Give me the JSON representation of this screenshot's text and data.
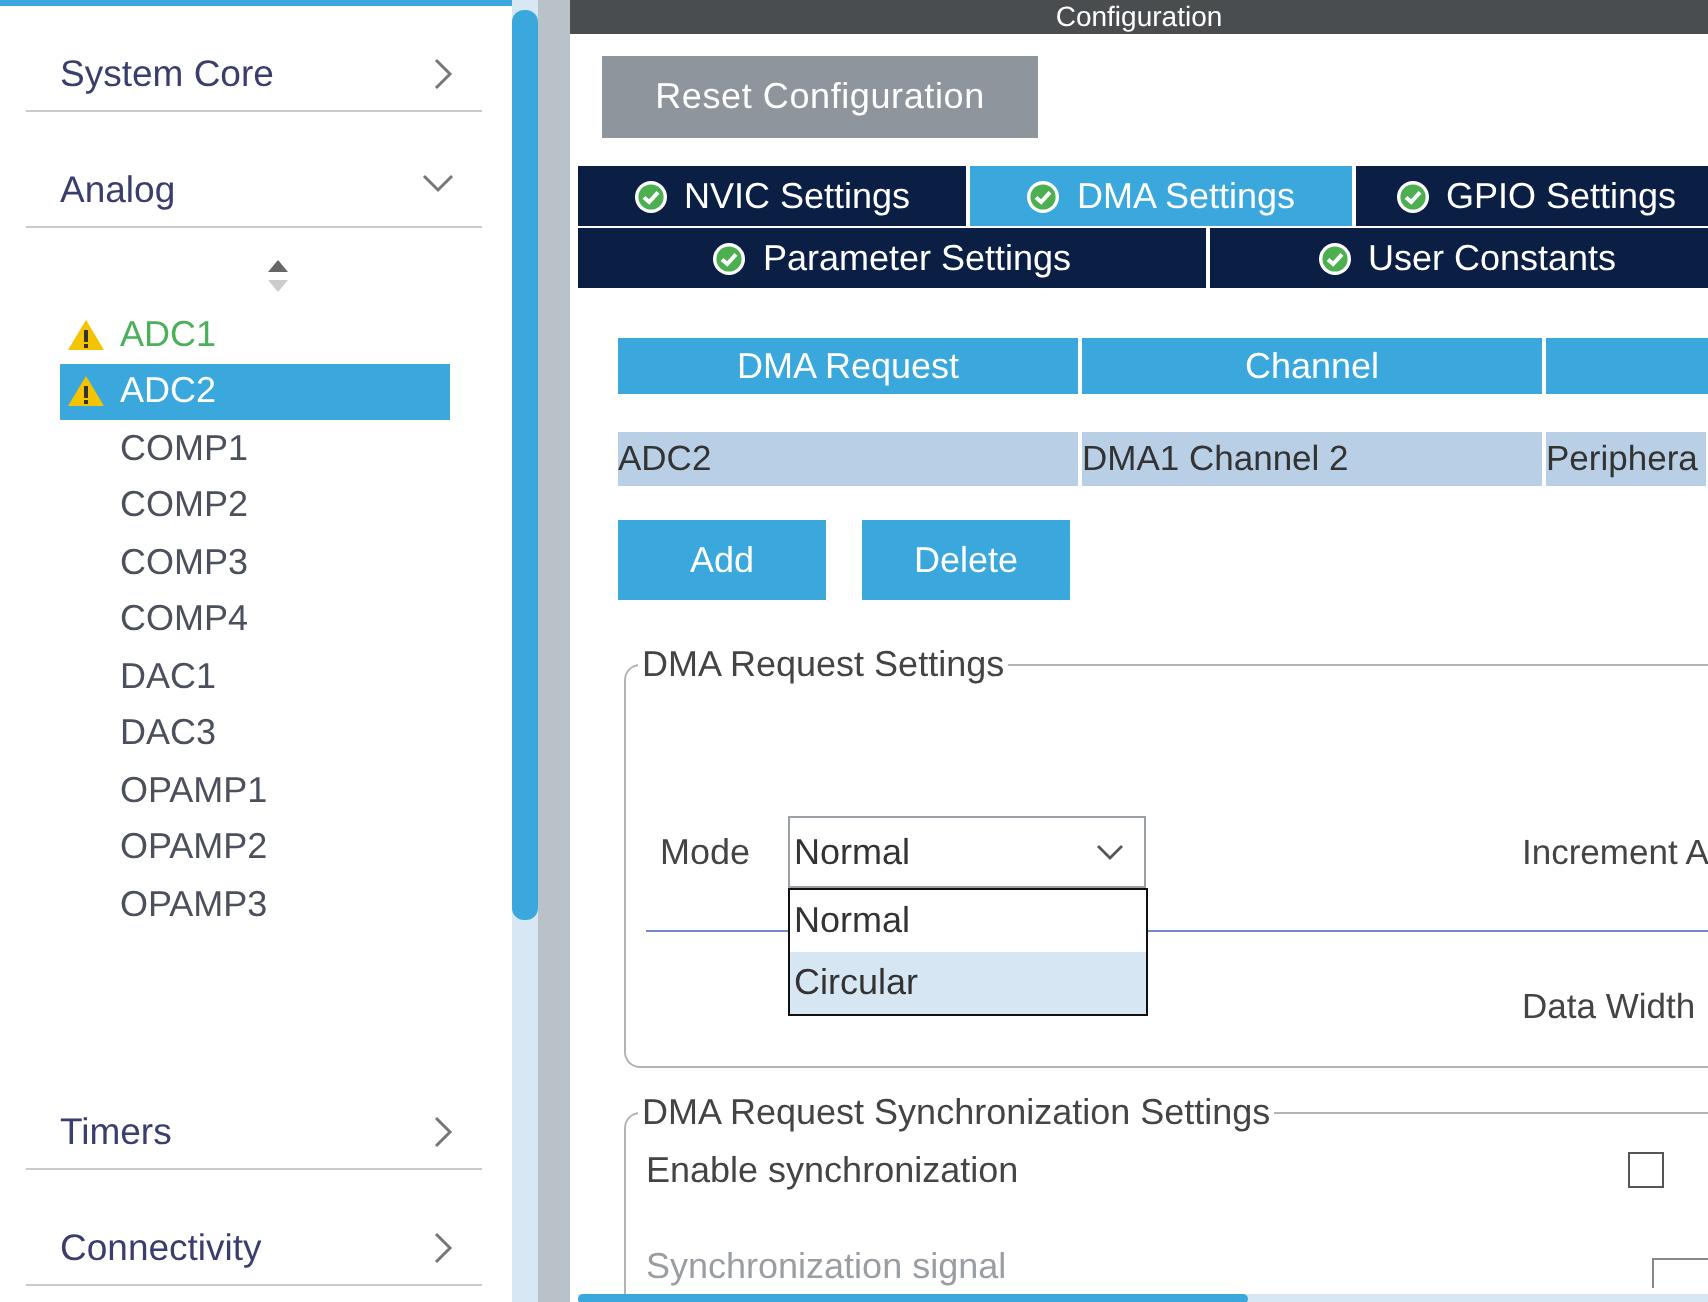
{
  "sidebar": {
    "categories": [
      {
        "label": "System Core",
        "expanded": false
      },
      {
        "label": "Analog",
        "expanded": true,
        "items": [
          {
            "label": "ADC1",
            "warning": true,
            "configured": true,
            "selected": false
          },
          {
            "label": "ADC2",
            "warning": true,
            "configured": true,
            "selected": true
          },
          {
            "label": "COMP1",
            "warning": false,
            "configured": false,
            "selected": false
          },
          {
            "label": "COMP2",
            "warning": false,
            "configured": false,
            "selected": false
          },
          {
            "label": "COMP3",
            "warning": false,
            "configured": false,
            "selected": false
          },
          {
            "label": "COMP4",
            "warning": false,
            "configured": false,
            "selected": false
          },
          {
            "label": "DAC1",
            "warning": false,
            "configured": false,
            "selected": false
          },
          {
            "label": "DAC3",
            "warning": false,
            "configured": false,
            "selected": false
          },
          {
            "label": "OPAMP1",
            "warning": false,
            "configured": false,
            "selected": false
          },
          {
            "label": "OPAMP2",
            "warning": false,
            "configured": false,
            "selected": false
          },
          {
            "label": "OPAMP3",
            "warning": false,
            "configured": false,
            "selected": false
          }
        ]
      },
      {
        "label": "Timers",
        "expanded": false
      },
      {
        "label": "Connectivity",
        "expanded": false
      }
    ]
  },
  "panel": {
    "title": "Configuration",
    "reset_button": "Reset Configuration",
    "tab_rows": [
      {
        "tabs": [
          {
            "label": "NVIC Settings",
            "selected": false
          },
          {
            "label": "DMA Settings",
            "selected": true
          },
          {
            "label": "GPIO Settings",
            "selected": false
          }
        ]
      },
      {
        "tabs": [
          {
            "label": "Parameter Settings",
            "selected": false
          },
          {
            "label": "User Constants",
            "selected": false
          }
        ]
      }
    ],
    "dma_table": {
      "columns": [
        "DMA Request",
        "Channel"
      ],
      "rows": [
        {
          "cells": [
            "ADC2",
            "DMA1 Channel 2",
            "Periphera"
          ],
          "selected": true
        }
      ]
    },
    "buttons": [
      "Add",
      "Delete"
    ],
    "request_settings": {
      "title": "DMA Request Settings",
      "mode": {
        "label": "Mode",
        "value": "Normal",
        "open": true,
        "options": [
          {
            "label": "Normal",
            "highlighted": false
          },
          {
            "label": "Circular",
            "highlighted": true
          }
        ]
      },
      "increment_label": "Increment A",
      "data_width_label": "Data Width"
    },
    "sync_settings": {
      "title": "DMA Request Synchronization Settings",
      "fields": [
        {
          "label": "Enable synchronization",
          "kind": "checkbox",
          "checked": false,
          "disabled": false
        },
        {
          "label": "Synchronization signal",
          "kind": "field",
          "disabled": true
        }
      ]
    }
  }
}
